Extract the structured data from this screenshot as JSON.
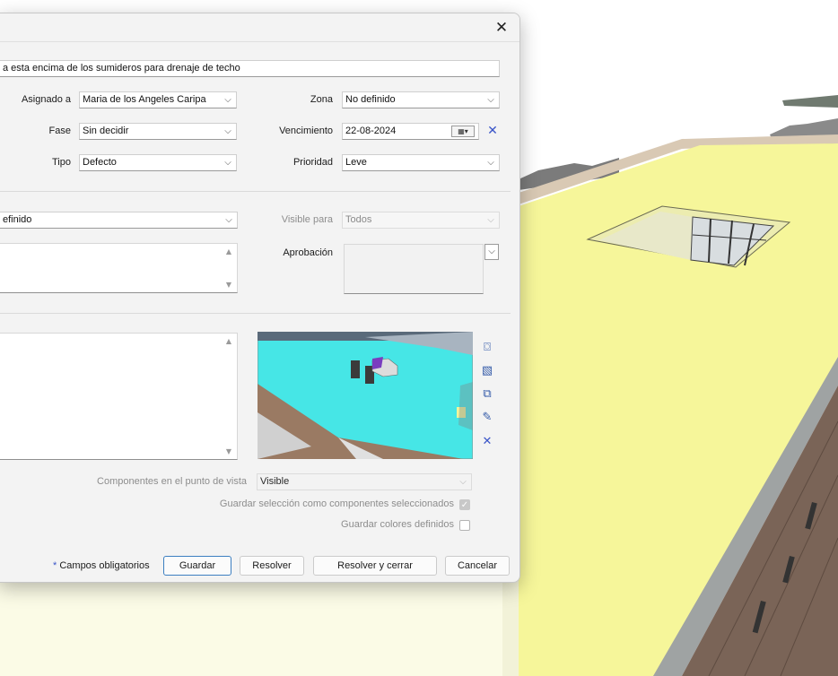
{
  "dialog": {
    "close_glyph": "✕",
    "summary_value": "a esta encima de los sumideros para drenaje de techo",
    "fields": {
      "assigned_label": "Asignado a",
      "assigned_value": "Maria de los Angeles Caripa",
      "zone_label": "Zona",
      "zone_value": "No definido",
      "phase_label": "Fase",
      "phase_value": "Sin decidir",
      "due_label": "Vencimiento",
      "due_value": "22-08-2024",
      "type_label": "Tipo",
      "type_value": "Defecto",
      "priority_label": "Prioridad",
      "priority_value": "Leve",
      "category_value": "efinido",
      "visible_for_label": "Visible para",
      "visible_for_value": "Todos",
      "approval_label": "Aprobación"
    },
    "viewpoint": {
      "components_label": "Componentes en el punto de vista",
      "components_value": "Visible",
      "save_selection_label": "Guardar selección como componentes seleccionados",
      "save_selection_checked": true,
      "save_colors_label": "Guardar colores definidos",
      "save_colors_checked": false
    },
    "footer": {
      "required_marker": "*",
      "required_label": "Campos obligatorios",
      "save_label": "Guardar",
      "resolve_label": "Resolver",
      "resolve_close_label": "Resolver y cerrar",
      "cancel_label": "Cancelar"
    },
    "side_icons": [
      "camera-icon",
      "image-icon",
      "clipboard-copy-icon",
      "pencil-icon",
      "remove-x-icon"
    ],
    "colors": {
      "accent": "#3c7fc1",
      "clear_x": "#3a55c8",
      "roof_yellow": "#f6f69a"
    }
  }
}
